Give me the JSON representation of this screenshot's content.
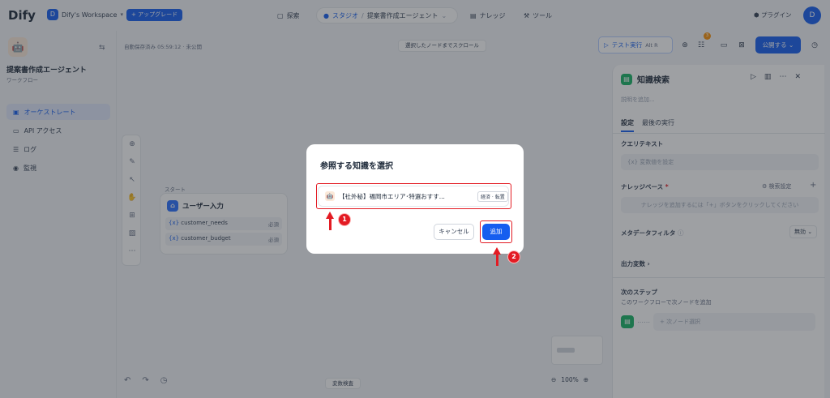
{
  "topbar": {
    "logo_main": "Dify",
    "workspace_avatar": "D",
    "workspace_name": "Dify's Workspace",
    "upgrade_label": "+ アップグレード",
    "nav_search": "探索",
    "nav_studio": "スタジオ",
    "nav_current_app": "提案書作成エージェント",
    "nav_knowledge": "ナレッジ",
    "nav_tools": "ツール",
    "plugin_label": "プラグイン",
    "user_avatar": "D"
  },
  "sidebar": {
    "app_title": "提案書作成エージェント",
    "app_type": "ワークフロー",
    "items": [
      {
        "label": "オーケストレート",
        "active": true
      },
      {
        "label": "API アクセス",
        "active": false
      },
      {
        "label": "ログ",
        "active": false
      },
      {
        "label": "監視",
        "active": false
      }
    ]
  },
  "canvas": {
    "autosave_text": "自動保存済み 05:59:12 · 未公開",
    "scroll_button": "選択したノードまでスクロール",
    "start_label": "スタート",
    "node_title": "ユーザー入力",
    "variables": [
      {
        "name": "customer_needs",
        "required": "必須"
      },
      {
        "name": "customer_budget",
        "required": "必須"
      }
    ],
    "variable_check": "変数検査",
    "zoom_level": "100%"
  },
  "runbar": {
    "test_run": "テスト実行",
    "shortcut": "Alt  R",
    "badge_count": "3",
    "publish": "公開する"
  },
  "panel": {
    "title": "知識検索",
    "description_placeholder": "説明を追加...",
    "tab_settings": "設定",
    "tab_last_run": "最後の実行",
    "query_text_label": "クエリテキスト",
    "query_text_placeholder": "変数値を設定",
    "knowledge_base_label": "ナレッジベース",
    "knowledge_base_required": "*",
    "retrieval_settings": "検索設定",
    "knowledge_hint": "ナレッジを追加するには「+」ボタンをクリックしてください",
    "metadata_filter_label": "メタデータフィルタ",
    "metadata_filter_value": "無効",
    "output_vars_label": "出力変数",
    "next_step_label": "次のステップ",
    "next_step_desc": "このワークフローで次ノードを追加",
    "next_node_placeholder": "次ノード選択"
  },
  "modal": {
    "title": "参照する知識を選択",
    "item_name": "【社外秘】福岡市エリア･特選おすす...",
    "item_tag": "経済 · 転置",
    "cancel": "キャンセル",
    "add": "追加",
    "annotation_1": "1",
    "annotation_2": "2"
  },
  "colors": {
    "accent": "#155eef",
    "highlight": "#e31b23",
    "success": "#16b364"
  }
}
